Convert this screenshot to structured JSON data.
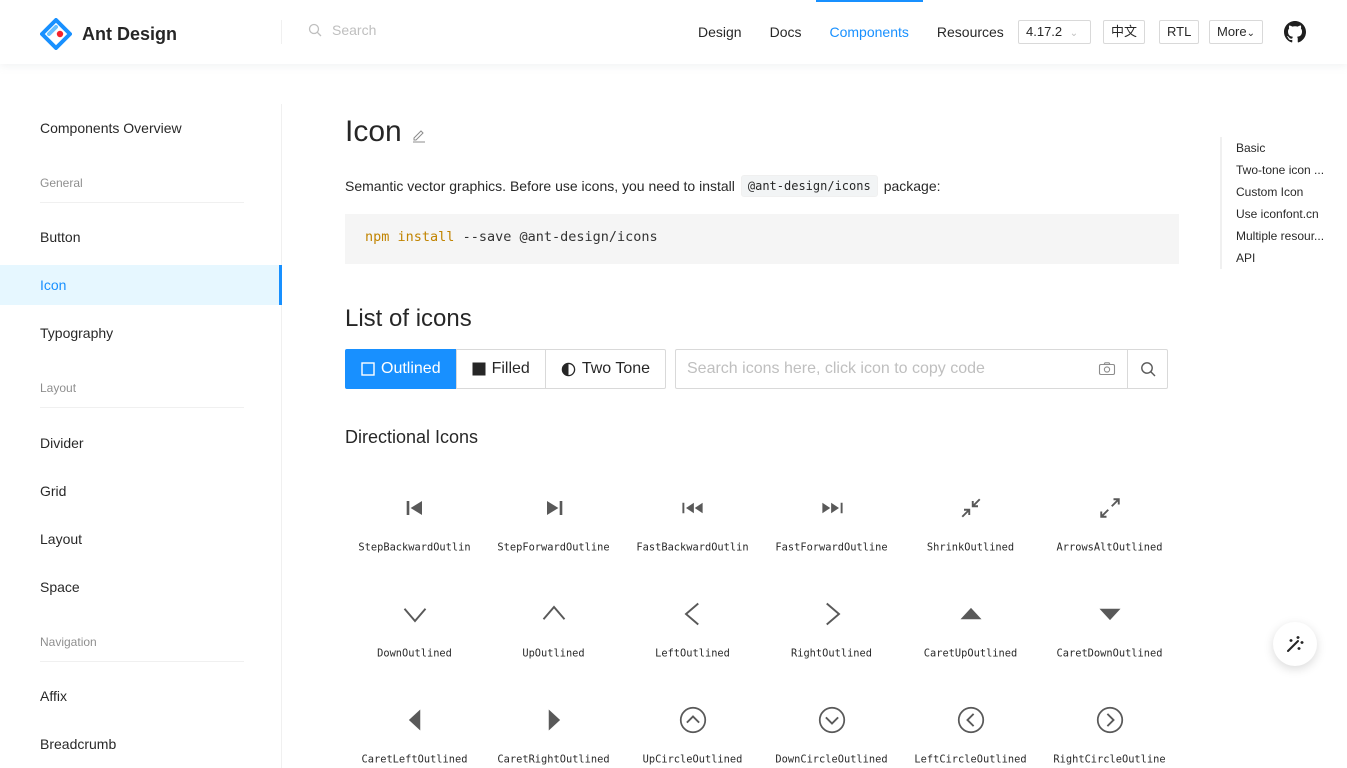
{
  "header": {
    "brand": "Ant Design",
    "search_placeholder": "Search",
    "nav": [
      "Design",
      "Docs",
      "Components",
      "Resources"
    ],
    "active_nav": "Components",
    "version": "4.17.2",
    "lang": "中文",
    "rtl": "RTL",
    "more": "More"
  },
  "sidebar": {
    "overview": "Components Overview",
    "group_general": "General",
    "button": "Button",
    "icon": "Icon",
    "typography": "Typography",
    "group_layout": "Layout",
    "divider": "Divider",
    "grid": "Grid",
    "layout": "Layout",
    "space": "Space",
    "group_navigation": "Navigation",
    "affix": "Affix",
    "breadcrumb": "Breadcrumb"
  },
  "main": {
    "title": "Icon",
    "desc_before": "Semantic vector graphics. Before use icons, you need to install",
    "desc_code": "@ant-design/icons",
    "desc_after": "package:",
    "code_npm": "npm",
    "code_install": "install",
    "code_rest": "--save @ant-design/icons",
    "list_title": "List of icons",
    "themes": {
      "outlined": "Outlined",
      "filled": "Filled",
      "twotone": "Two Tone"
    },
    "search_placeholder": "Search icons here, click icon to copy code",
    "section_title": "Directional Icons",
    "icons": [
      {
        "name": "StepBackwardOutlin",
        "icon": "step-backward"
      },
      {
        "name": "StepForwardOutline",
        "icon": "step-forward"
      },
      {
        "name": "FastBackwardOutlin",
        "icon": "fast-backward"
      },
      {
        "name": "FastForwardOutline",
        "icon": "fast-forward"
      },
      {
        "name": "ShrinkOutlined",
        "icon": "shrink"
      },
      {
        "name": "ArrowsAltOutlined",
        "icon": "arrows-alt"
      },
      {
        "name": "DownOutlined",
        "icon": "down"
      },
      {
        "name": "UpOutlined",
        "icon": "up"
      },
      {
        "name": "LeftOutlined",
        "icon": "left"
      },
      {
        "name": "RightOutlined",
        "icon": "right"
      },
      {
        "name": "CaretUpOutlined",
        "icon": "caret-up"
      },
      {
        "name": "CaretDownOutlined",
        "icon": "caret-down"
      },
      {
        "name": "CaretLeftOutlined",
        "icon": "caret-left"
      },
      {
        "name": "CaretRightOutlined",
        "icon": "caret-right"
      },
      {
        "name": "UpCircleOutlined",
        "icon": "up-circle"
      },
      {
        "name": "DownCircleOutlined",
        "icon": "down-circle"
      },
      {
        "name": "LeftCircleOutlined",
        "icon": "left-circle"
      },
      {
        "name": "RightCircleOutline",
        "icon": "right-circle"
      }
    ]
  },
  "anchor": [
    "Basic",
    "Two-tone icon ...",
    "Custom Icon",
    "Use iconfont.cn",
    "Multiple resour...",
    "API"
  ],
  "colors": {
    "primary": "#1890ff",
    "active_bg": "#e6f7ff"
  }
}
